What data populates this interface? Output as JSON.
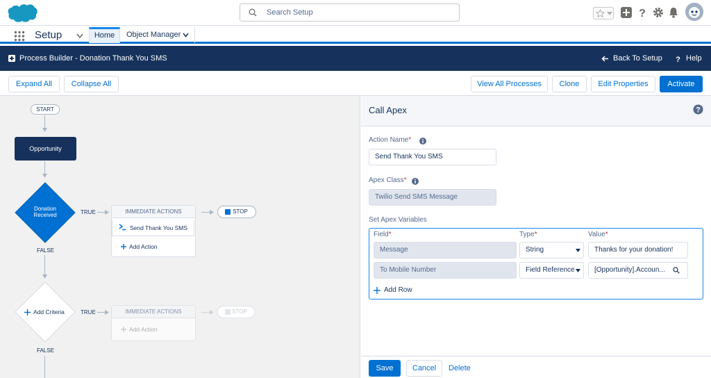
{
  "global_header": {
    "search_placeholder": "Search Setup"
  },
  "context_bar": {
    "app_name": "Setup",
    "tabs": [
      {
        "label": "Home"
      },
      {
        "label": "Object Manager"
      }
    ]
  },
  "pb_header": {
    "title": "Process Builder - Donation Thank You SMS",
    "back_label": "Back To Setup",
    "help_label": "Help"
  },
  "toolbar": {
    "expand_all": "Expand All",
    "collapse_all": "Collapse All",
    "view_all_processes": "View All Processes",
    "clone": "Clone",
    "edit_properties": "Edit Properties",
    "activate": "Activate"
  },
  "canvas": {
    "start": "START",
    "object_node": "Opportunity",
    "criteria1": "Donation Received",
    "criteria1_line1": "Donation",
    "criteria1_line2": "Received",
    "true_label": "TRUE",
    "false_label": "FALSE",
    "immediate_actions": "IMMEDIATE ACTIONS",
    "action1": "Send Thank You SMS",
    "add_action": "Add Action",
    "stop": "STOP",
    "add_criteria": "Add Criteria"
  },
  "panel": {
    "title": "Call Apex",
    "action_name_label": "Action Name",
    "action_name_value": "Send Thank You SMS",
    "apex_class_label": "Apex Class",
    "apex_class_value": "Twilio Send SMS Message",
    "set_vars_label": "Set Apex Variables",
    "col_field": "Field",
    "col_type": "Type",
    "col_value": "Value",
    "rows": [
      {
        "field": "Message",
        "type": "String",
        "value": "Thanks for your donation!"
      },
      {
        "field": "To Mobile Number",
        "type": "Field Reference",
        "value": "[Opportunity].Accoun..."
      }
    ],
    "add_row": "Add Row",
    "save": "Save",
    "cancel": "Cancel",
    "delete": "Delete"
  },
  "colors": {
    "brand": "#0070d2",
    "header_dark": "#16325c",
    "required": "#c23934"
  }
}
